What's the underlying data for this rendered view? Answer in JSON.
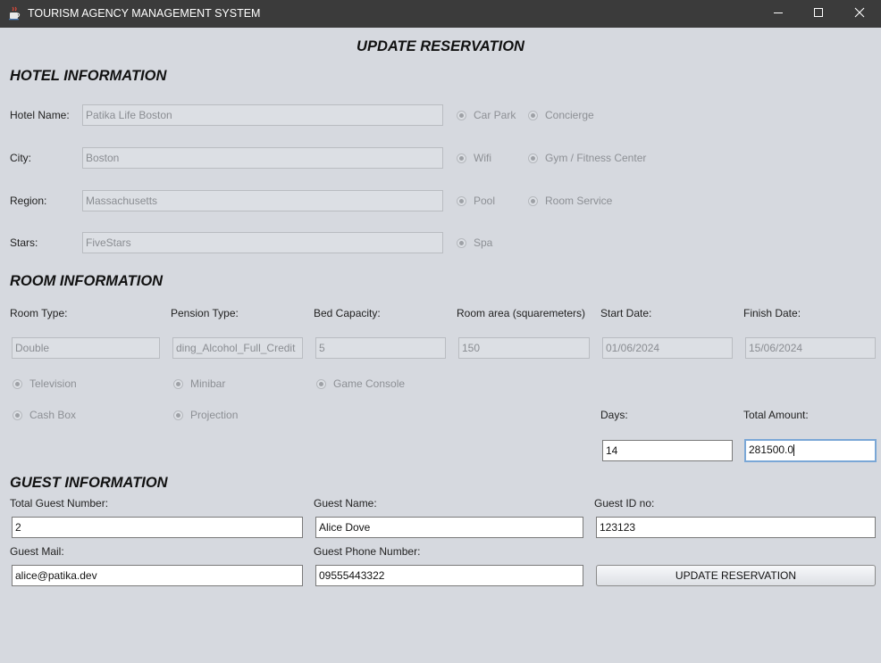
{
  "window": {
    "title": "TOURISM AGENCY MANAGEMENT SYSTEM",
    "icons": {
      "app": "java-cup-icon",
      "minimize": "minimize-icon",
      "maximize": "maximize-icon",
      "close": "close-icon"
    }
  },
  "page_title": "UPDATE RESERVATION",
  "hotel": {
    "section_title": "HOTEL INFORMATION",
    "name_label": "Hotel Name:",
    "name_value": "Patika Life Boston",
    "city_label": "City:",
    "city_value": "Boston",
    "region_label": "Region:",
    "region_value": "Massachusetts",
    "stars_label": "Stars:",
    "stars_value": "FiveStars",
    "features": {
      "car_park": "Car Park",
      "concierge": "Concierge",
      "wifi": "Wifi",
      "gym": "Gym / Fitness Center",
      "pool": "Pool",
      "room_service": "Room Service",
      "spa": "Spa"
    }
  },
  "room": {
    "section_title": "ROOM INFORMATION",
    "type_label": "Room Type:",
    "type_value": "Double",
    "pension_label": "Pension Type:",
    "pension_value": "ding_Alcohol_Full_Credit",
    "bed_label": "Bed Capacity:",
    "bed_value": "5",
    "area_label": "Room area (squaremeters)",
    "area_value": "150",
    "start_label": "Start Date:",
    "start_value": "01/06/2024",
    "finish_label": "Finish Date:",
    "finish_value": "15/06/2024",
    "features": {
      "television": "Television",
      "minibar": "Minibar",
      "game_console": "Game Console",
      "cash_box": "Cash Box",
      "projection": "Projection"
    },
    "days_label": "Days:",
    "days_value": "14",
    "total_label": "Total Amount:",
    "total_value": "281500.0"
  },
  "guest": {
    "section_title": "GUEST INFORMATION",
    "total_label": "Total Guest Number:",
    "total_value": "2",
    "name_label": "Guest Name:",
    "name_value": "Alice Dove",
    "id_label": "Guest ID no:",
    "id_value": "123123",
    "mail_label": "Guest Mail:",
    "mail_value": "alice@patika.dev",
    "phone_label": "Guest Phone Number:",
    "phone_value": "09555443322",
    "update_button": "UPDATE RESERVATION"
  }
}
